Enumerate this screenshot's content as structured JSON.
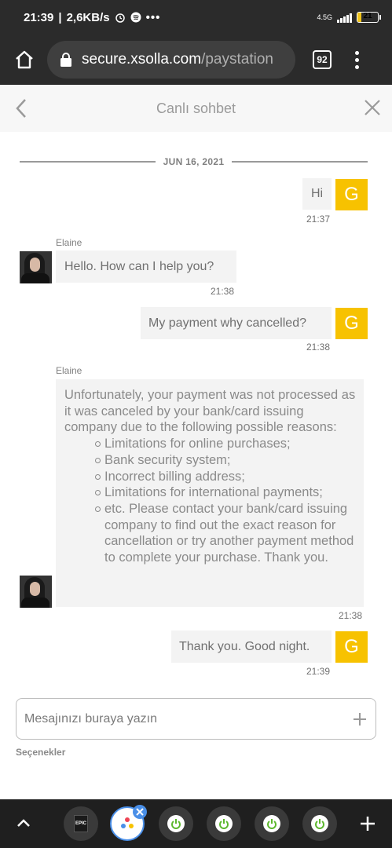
{
  "status_bar": {
    "time": "21:39",
    "speed": "2,6KB/s",
    "network": "4.5G",
    "battery": "21",
    "battery_level": 0.21
  },
  "browser": {
    "url_domain": "secure.xsolla.com",
    "url_path": "/paystation",
    "tab_count": "92"
  },
  "chat": {
    "title": "Canlı sohbet",
    "date": "JUN 16, 2021",
    "agent_name": "Elaine",
    "user_initial": "G",
    "messages": [
      {
        "from": "user",
        "text": "Hi",
        "time": "21:37"
      },
      {
        "from": "agent",
        "sender": "Elaine",
        "text": "Hello. How can I help you?",
        "time": "21:38"
      },
      {
        "from": "user",
        "text": "My payment why cancelled?",
        "time": "21:38"
      },
      {
        "from": "agent",
        "sender": "Elaine",
        "intro": "Unfortunately, your payment was not processed as it was canceled by your bank/card issuing company due to the following possible reasons:",
        "bullets": [
          "Limitations for online purchases;",
          "Bank security system;",
          "Incorrect billing address;",
          "Limitations for international payments;",
          "etc. Please contact your bank/card issuing company to find out the exact reason for cancellation or try another payment method to complete your purchase. Thank you."
        ],
        "time": "21:38"
      },
      {
        "from": "user",
        "text": "Thank you. Good night.",
        "time": "21:39"
      }
    ]
  },
  "input": {
    "placeholder": "Mesajınızı buraya yazın",
    "options_label": "Seçenekler"
  },
  "bottom_bar": {
    "items": [
      "expand-icon",
      "epic-games-icon",
      "active-game-icon",
      "power-icon",
      "power-icon",
      "power-icon",
      "power-icon",
      "plus-icon"
    ]
  },
  "colors": {
    "accent_yellow": "#f7c200",
    "bubble_bg": "#f3f3f3",
    "power_green": "#5cb82d"
  }
}
